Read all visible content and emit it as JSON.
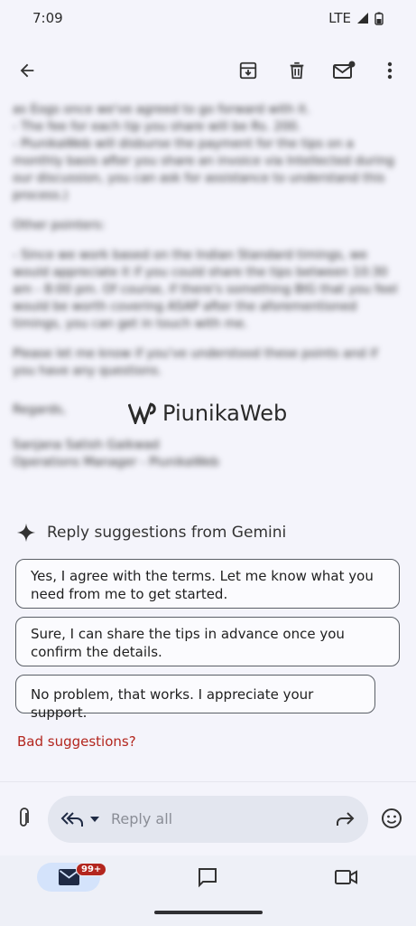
{
  "status_bar": {
    "time": "7:09",
    "network": "LTE"
  },
  "toolbar": {
    "back": "arrow-left-icon",
    "archive": "archive-icon",
    "delete": "trash-icon",
    "mark_unread": "mark-unread-icon",
    "more": "more-vert-icon"
  },
  "email": {
    "paragraphs": [
      "as Eogs once we've agreed to go forward with it.",
      "- The fee for each tip you share will be Rs. 200.",
      "- PiunikaWeb will disburse the payment for the tips on a monthly basis after you share an invoice via Intellected during our discussion, you can ask for assistance to understand this process.)",
      "Other pointers:",
      "- Since we work based on the Indian Standard timings, we would appreciate it if you could share the tips between 10:30 am - 8:00 pm. Of course, if there's something BIG that you feel would be worth covering ASAP after the aforementioned timings, you can get in touch with me.",
      "Please let me know if you've understood these points and if you have any questions.",
      "Regards,",
      "Sanjana Satish Gaikwad",
      "Operations Manager - PiunikaWeb"
    ],
    "watermark": "PiunikaWeb"
  },
  "gemini": {
    "title": "Reply suggestions from Gemini",
    "suggestions": [
      "Yes, I agree with the terms. Let me know what you need from me to get started.",
      "Sure, I can share the tips in advance once you confirm the details.",
      "No problem, that works. I appreciate your support."
    ],
    "bad_link": "Bad suggestions?"
  },
  "reply": {
    "placeholder": "Reply all"
  },
  "nav": {
    "mail_badge": "99+"
  },
  "colors": {
    "accent_red": "#b3261e",
    "pill": "#d4e3fb"
  }
}
